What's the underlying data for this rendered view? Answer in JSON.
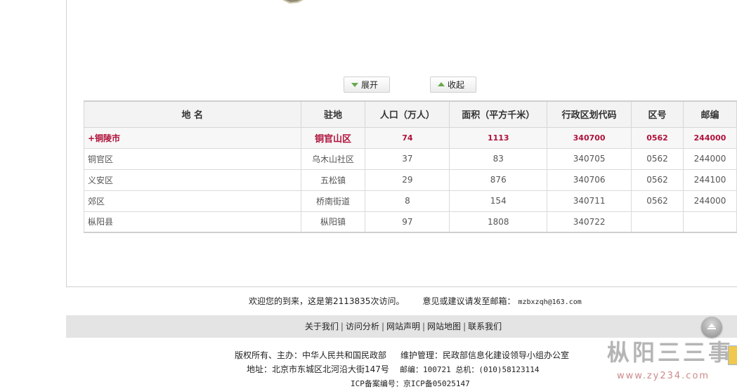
{
  "toggles": {
    "expand": "展开",
    "collapse": "收起"
  },
  "table": {
    "headers": [
      "地 名",
      "驻地",
      "人口（万人）",
      "面积（平方千米）",
      "行政区划代码",
      "区号",
      "邮编"
    ],
    "rows": [
      {
        "name": "+铜陵市",
        "seat": "铜官山区",
        "population": "74",
        "area": "1113",
        "code": "340700",
        "area_code": "0562",
        "postcode": "244000"
      },
      {
        "name": "铜官区",
        "seat": "乌木山社区",
        "population": "37",
        "area": "83",
        "code": "340705",
        "area_code": "0562",
        "postcode": "244000"
      },
      {
        "name": "义安区",
        "seat": "五松镇",
        "population": "29",
        "area": "876",
        "code": "340706",
        "area_code": "0562",
        "postcode": "244100"
      },
      {
        "name": "郊区",
        "seat": "桥南街道",
        "population": "8",
        "area": "154",
        "code": "340711",
        "area_code": "0562",
        "postcode": "244000"
      },
      {
        "name": "枞阳县",
        "seat": "枞阳镇",
        "population": "97",
        "area": "1808",
        "code": "340722",
        "area_code": "",
        "postcode": ""
      }
    ]
  },
  "visit": {
    "welcome": "欢迎您的到来，这是第2113835次访问。",
    "feedback": "意见或建议请发至邮箱：",
    "email": "mzbxzqh@163.com"
  },
  "footer_links": [
    "关于我们",
    "访问分析",
    "网站声明",
    "网站地图",
    "联系我们"
  ],
  "footer_info": {
    "copyright": "版权所有、主办：中华人民共和国民政部",
    "maintainer": "维护管理：民政部信息化建设领导小组办公室",
    "address": "地址：北京市东城区北河沿大街147号",
    "postal": "邮编：100721 总机：(010)58123114",
    "icp": "ICP备案编号：京ICP备05025147"
  },
  "watermark": {
    "title": "枞阳三三事",
    "url": "www.zy234.com"
  },
  "icons": {
    "expand": "triangle-down-icon",
    "collapse": "triangle-up-icon",
    "back_to_top": "back-to-top-icon"
  },
  "colors": {
    "city_row_text": "#b0123b",
    "footer_bar": "#e4e4e4",
    "arrow": "#6aa84f"
  }
}
